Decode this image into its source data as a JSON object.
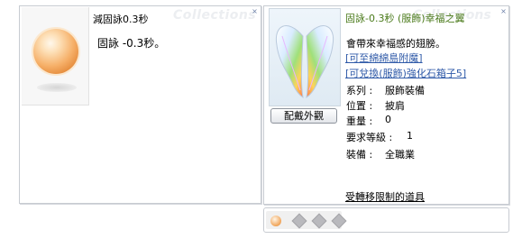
{
  "left_window": {
    "watermark": "Collections",
    "title": "減固詠0.3秒",
    "description": "固詠 -0.3秒。",
    "close_glyph": "×"
  },
  "right_window": {
    "watermark": "Collections",
    "title": "固詠-0.3秒 (服飾)幸福之翼",
    "close_glyph": "×",
    "description": "會帶來幸福感的翅膀。",
    "links": [
      "[可至綿綿島附魔]",
      "[可兌換(服飾)強化石箱子5]"
    ],
    "stats": [
      {
        "label": "系列 :",
        "value": "服飾裝備"
      },
      {
        "label": "位置 :",
        "value": "披肩"
      },
      {
        "label": "重量 :",
        "value": "0"
      },
      {
        "label": "要求等級 :",
        "value": "1"
      },
      {
        "label": "裝備 :",
        "value": "全職業"
      }
    ],
    "preview_button": "配戴外觀",
    "restriction_link": "受轉移限制的道具"
  },
  "slot_bar": {
    "slots": [
      "orb-slot",
      "empty-card-slot",
      "empty-card-slot",
      "empty-card-slot"
    ]
  },
  "colors": {
    "title_green": "#4a7a1a",
    "link_blue": "#2f5aa8",
    "border": "#c7cbd1"
  }
}
